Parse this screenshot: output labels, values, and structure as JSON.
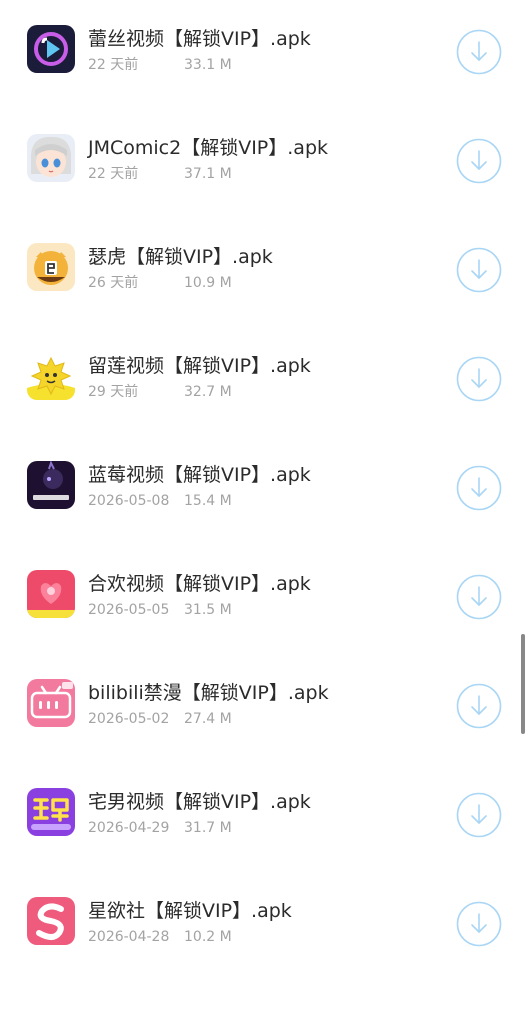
{
  "files": [
    {
      "name": "蕾丝视频【解锁VIP】.apk",
      "date": "22 天前",
      "size": "33.1 M",
      "icon": "leisi-app-icon",
      "color": "#1b1b3a"
    },
    {
      "name": "JMComic2【解锁VIP】.apk",
      "date": "22 天前",
      "size": "37.1 M",
      "icon": "jmcomic-app-icon",
      "color": "#e7eef7"
    },
    {
      "name": "瑟虎【解锁VIP】.apk",
      "date": "26 天前",
      "size": "10.9 M",
      "icon": "sehu-app-icon",
      "color": "#f6c24a"
    },
    {
      "name": "留莲视频【解锁VIP】.apk",
      "date": "29 天前",
      "size": "32.7 M",
      "icon": "liulian-app-icon",
      "color": "#f3e34a"
    },
    {
      "name": "蓝莓视频【解锁VIP】.apk",
      "date": "2026-05-08",
      "size": "15.4 M",
      "icon": "lanmei-app-icon",
      "color": "#1e1030"
    },
    {
      "name": "合欢视频【解锁VIP】.apk",
      "date": "2026-05-05",
      "size": "31.5 M",
      "icon": "hehuan-app-icon",
      "color": "#ee4a6a"
    },
    {
      "name": "bilibili禁漫【解锁VIP】.apk",
      "date": "2026-05-02",
      "size": "27.4 M",
      "icon": "bilibili-app-icon",
      "color": "#f27a9e"
    },
    {
      "name": "宅男视频【解锁VIP】.apk",
      "date": "2026-04-29",
      "size": "31.7 M",
      "icon": "zhainan-app-icon",
      "color": "#8a3fe0"
    },
    {
      "name": "星欲社【解锁VIP】.apk",
      "date": "2026-04-28",
      "size": "10.2 M",
      "icon": "xingyu-app-icon",
      "color": "#ef5b7c"
    }
  ],
  "download_icon_color": "#a9d6f5"
}
